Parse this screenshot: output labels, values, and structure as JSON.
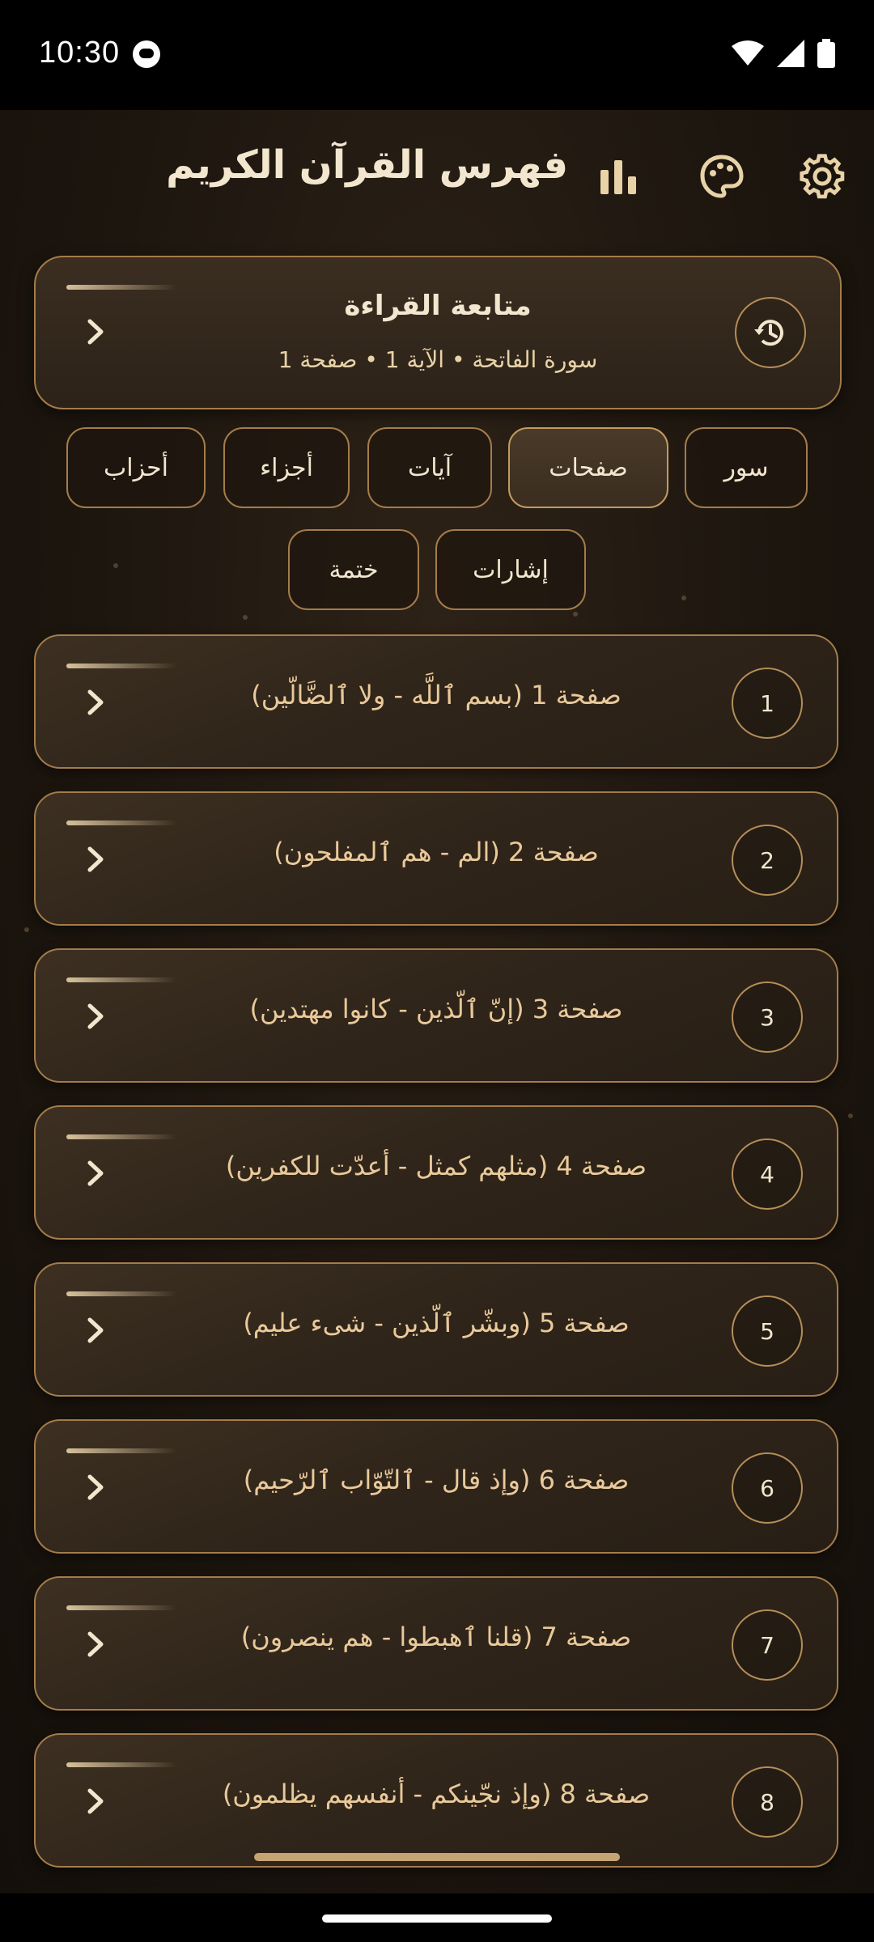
{
  "status_bar": {
    "time": "10:30"
  },
  "header": {
    "title": "فهرس القرآن الكريم"
  },
  "resume": {
    "title": "متابعة القراءة",
    "subtitle": "سورة الفاتحة • الآية 1 • صفحة 1"
  },
  "tabs": [
    {
      "label": "سور",
      "active": false
    },
    {
      "label": "صفحات",
      "active": true
    },
    {
      "label": "آيات",
      "active": false
    },
    {
      "label": "أجزاء",
      "active": false
    },
    {
      "label": "أحزاب",
      "active": false
    },
    {
      "label": "إشارات",
      "active": false
    },
    {
      "label": "ختمة",
      "active": false
    }
  ],
  "pages": [
    {
      "number": "1",
      "label": "صفحة 1 (بسم ٱللَّه - ولا ٱلضَّالّين)"
    },
    {
      "number": "2",
      "label": "صفحة 2 (الم - هم ٱلمفلحون)"
    },
    {
      "number": "3",
      "label": "صفحة 3 (إنّ ٱلّذين - كانوا مهتدين)"
    },
    {
      "number": "4",
      "label": "صفحة 4 (مثلهم كمثل - أعدّت للكفرين)"
    },
    {
      "number": "5",
      "label": "صفحة 5 (وبشّر ٱلّذين - شىء عليم)"
    },
    {
      "number": "6",
      "label": "صفحة 6 (وإذ قال - ٱلتّوّاب ٱلرّحيم)"
    },
    {
      "number": "7",
      "label": "صفحة 7 (قلنا ٱهبطوا - هم ينصرون)"
    },
    {
      "number": "8",
      "label": "صفحة 8 (وإذ نجّينكم - أنفسهم يظلمون)"
    }
  ],
  "colors": {
    "accent": "#a47c4a",
    "text": "#e9c99a",
    "background": "#1d160f"
  }
}
